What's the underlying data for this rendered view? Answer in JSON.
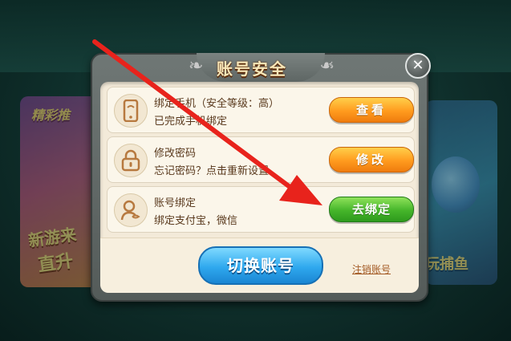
{
  "dialog": {
    "title": "账号安全",
    "close_glyph": "✕",
    "rows": [
      {
        "icon": "phone-icon",
        "title": "绑定手机（安全等级：高）",
        "subtitle": "已完成手机绑定",
        "button": "查看",
        "button_color": "#ff9b1e"
      },
      {
        "icon": "lock-icon",
        "title": "修改密码",
        "subtitle": "忘记密码？点击重新设置",
        "button": "修改",
        "button_color": "#ff9b1e"
      },
      {
        "icon": "user-link-icon",
        "title": "账号绑定",
        "subtitle": "绑定支付宝，微信",
        "button": "去绑定",
        "button_color": "#45b52a"
      }
    ],
    "switch_account": "切换账号",
    "logout": "注销账号"
  },
  "background": {
    "left_promo_title": "精彩推",
    "left_promo_line1": "新游来",
    "left_promo_line2": "直升",
    "right_promo_text": "玩捕鱼"
  },
  "overlay": {
    "arrow_color": "#e8231c"
  }
}
